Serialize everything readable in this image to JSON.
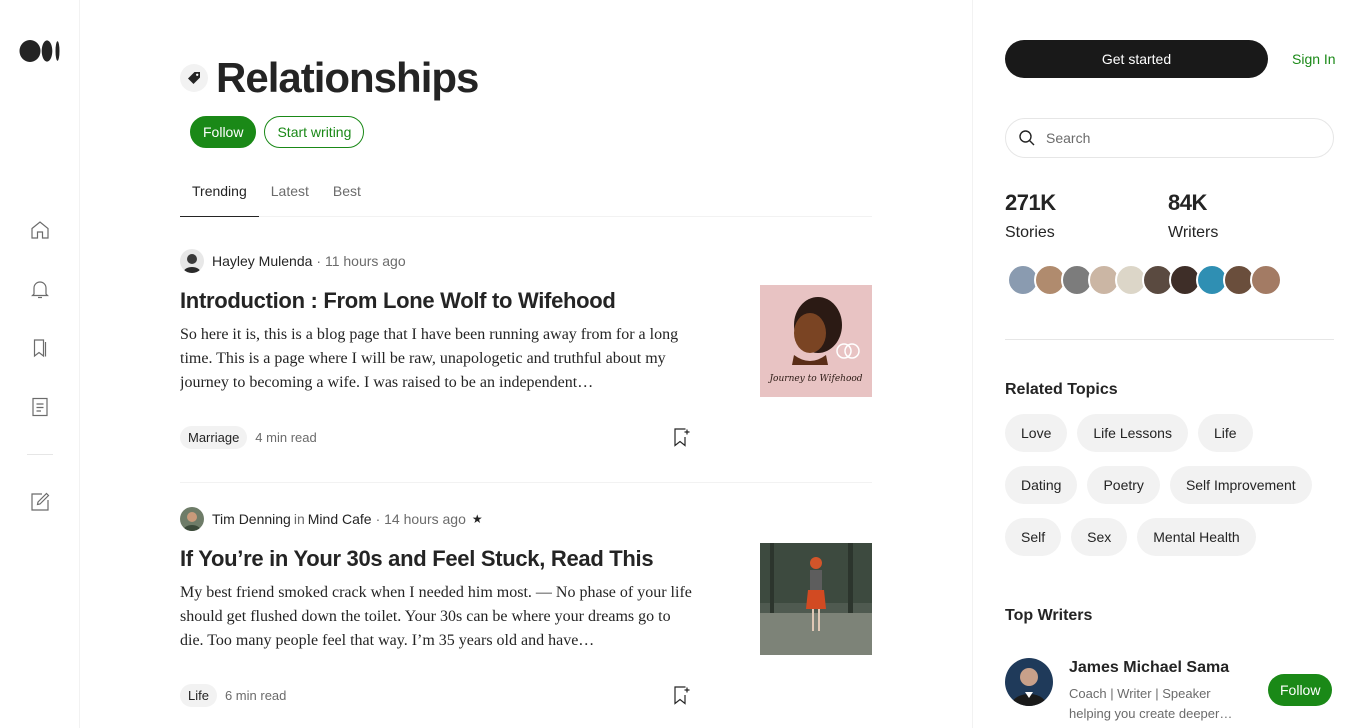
{
  "header": {
    "title": "Relationships",
    "follow_label": "Follow",
    "start_writing_label": "Start writing"
  },
  "tabs": [
    {
      "label": "Trending",
      "active": true
    },
    {
      "label": "Latest",
      "active": false
    },
    {
      "label": "Best",
      "active": false
    }
  ],
  "articles": [
    {
      "author": "Hayley Mulenda",
      "publication_prefix": "",
      "publication": "",
      "time": "· 11 hours ago",
      "star": "",
      "title": "Introduction : From Lone Wolf to Wifehood",
      "subtitle": "So here it is, this is a blog page that I have been running away from for a long time. This is a page where I will be raw, unapologetic and truthful about my journey to becoming a wife. I was raised to be an independent…",
      "tag": "Marriage",
      "read_time": "4 min read",
      "thumb_caption": "Journey to Wifehood"
    },
    {
      "author": "Tim Denning",
      "publication_prefix": "in",
      "publication": "Mind Cafe",
      "time": "· 14 hours ago",
      "star": "★",
      "title": "If You’re in Your 30s and Feel Stuck, Read This",
      "subtitle": "My best friend smoked crack when I needed him most. — No phase of your life should get flushed down the toilet. Your 30s can be where your dreams go to die. Too many people feel that way. I’m 35 years old and have…",
      "tag": "Life",
      "read_time": "6 min read"
    }
  ],
  "sidebar": {
    "get_started_label": "Get started",
    "sign_in_label": "Sign In",
    "search_placeholder": "Search",
    "stats": [
      {
        "value": "271K",
        "label": "Stories"
      },
      {
        "value": "84K",
        "label": "Writers"
      }
    ],
    "related_title": "Related Topics",
    "topics": [
      [
        "Love",
        "Life Lessons",
        "Life"
      ],
      [
        "Dating",
        "Poetry",
        "Self Improvement"
      ],
      [
        "Self",
        "Sex",
        "Mental Health"
      ]
    ],
    "top_writers_title": "Top Writers",
    "top_writer": {
      "name": "James Michael Sama",
      "bio": "Coach | Writer | Speaker helping you create deeper…",
      "follow_label": "Follow"
    }
  },
  "colors": {
    "accent": "#1a8917",
    "dark_button": "#191919",
    "text": "#242424",
    "muted": "#6b6b6b"
  }
}
